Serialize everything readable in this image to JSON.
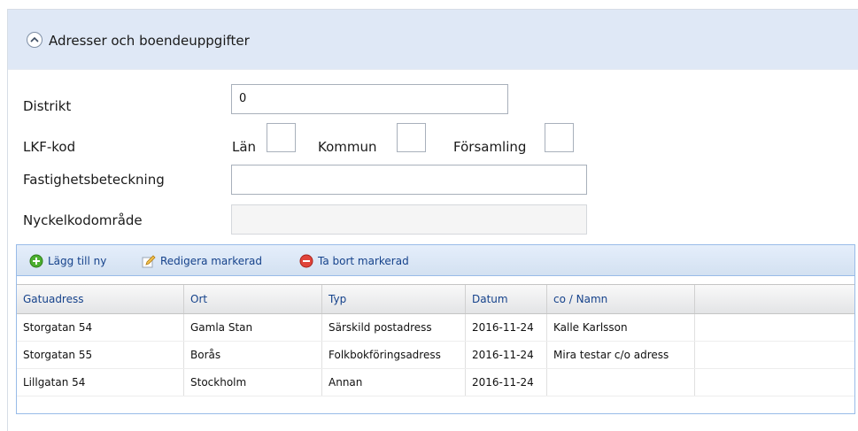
{
  "header": {
    "title": "Adresser och boendeuppgifter"
  },
  "form": {
    "distrikt": {
      "label": "Distrikt",
      "value": "0"
    },
    "lkf": {
      "label": "LKF-kod",
      "lan_label": "Län",
      "kommun_label": "Kommun",
      "forsamling_label": "Församling"
    },
    "fastighet": {
      "label": "Fastighetsbeteckning",
      "value": ""
    },
    "nyckel": {
      "label": "Nyckelkodområde",
      "value": ""
    }
  },
  "toolbar": {
    "add_label": "Lägg till ny",
    "edit_label": "Redigera markerad",
    "delete_label": "Ta bort markerad"
  },
  "table": {
    "columns": [
      "Gatuadress",
      "Ort",
      "Typ",
      "Datum",
      "co / Namn",
      ""
    ],
    "rows": [
      [
        "Storgatan 54",
        "Gamla Stan",
        "Särskild postadress",
        "2016-11-24",
        "Kalle Karlsson",
        ""
      ],
      [
        "Storgatan 55",
        "Borås",
        "Folkbokföringsadress",
        "2016-11-24",
        "Mira testar c/o adress",
        ""
      ],
      [
        "Lillgatan 54",
        "Stockholm",
        "Annan",
        "2016-11-24",
        "",
        ""
      ]
    ]
  },
  "colors": {
    "header_bg": "#dfe8f6",
    "grid_border": "#99bbe8",
    "link_text": "#15428b"
  }
}
